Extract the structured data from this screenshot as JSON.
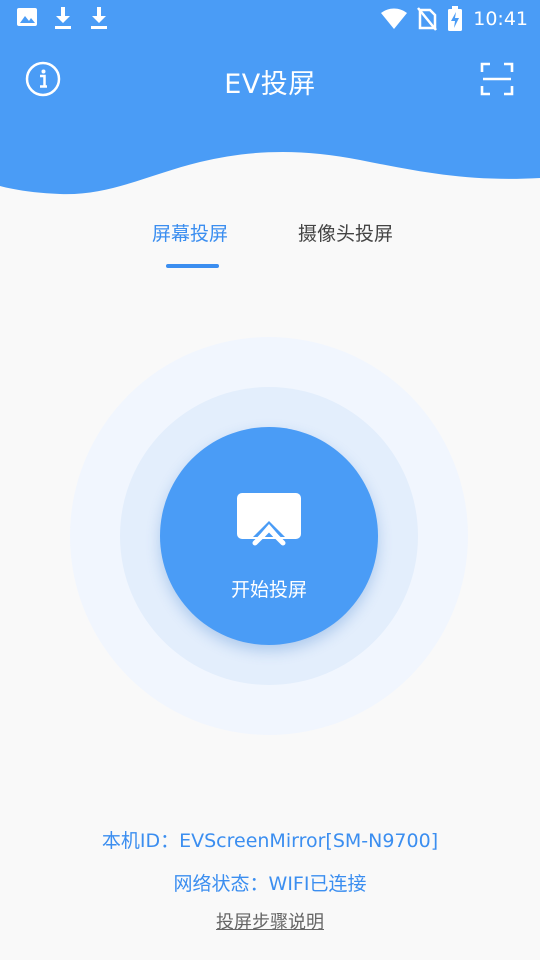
{
  "status_bar": {
    "time": "10:41",
    "left_icons": [
      "image-icon",
      "download-icon",
      "download-icon"
    ],
    "right_icons": [
      "wifi-icon",
      "no-sim-icon",
      "battery-charging-icon"
    ]
  },
  "app_bar": {
    "title": "EV投屏",
    "left_icon": "info-icon",
    "right_icon": "scan-icon",
    "color": "#4a9cf6"
  },
  "tabs": [
    {
      "label": "屏幕投屏",
      "active": true
    },
    {
      "label": "摄像头投屏",
      "active": false
    }
  ],
  "cast_button": {
    "label": "开始投屏",
    "icon": "screen-cast-icon"
  },
  "device_info": {
    "device_id": "本机ID：EVScreenMirror[SM-N9700]",
    "network_status": "网络状态：WIFI已连接"
  },
  "help_link": "投屏步骤说明",
  "colors": {
    "accent": "#3b8ef0",
    "header": "#4a9cf6"
  }
}
